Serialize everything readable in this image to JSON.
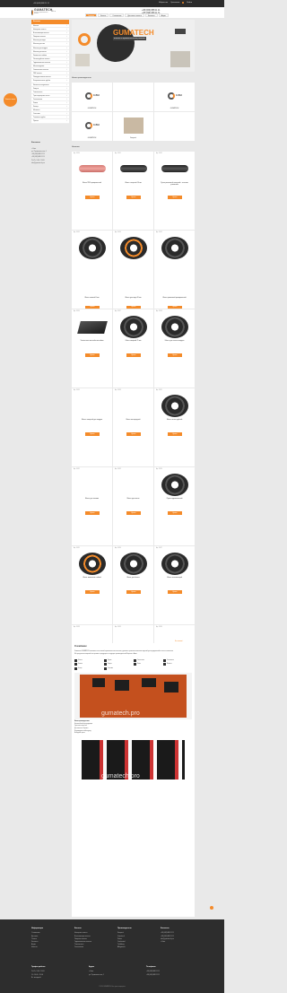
{
  "topbar": {
    "left_text": "+38 (063) 888 11 11",
    "right_items": [
      "Избранное",
      "Сравнение",
      "Войти"
    ]
  },
  "header": {
    "logo": "GUMATECH",
    "logo_tagline": "шланги и промышленные резинки",
    "language": "RU ▾",
    "phone1": "+38 (063) 888 11 11",
    "phone2": "+38 (096) 888 11 11",
    "nav": [
      "Главная",
      "Каталог",
      "О компании",
      "Доставка и оплата",
      "Контакты",
      "Акции"
    ]
  },
  "sidebar": {
    "title": "Каталог",
    "items": [
      "Шланги",
      "Напорные шланги",
      "Всасывающие шланги",
      "Пищевые шланги",
      "Шланги для воды",
      "Шланги для газа",
      "Шланги для воздуха",
      "Шланги для масла",
      "Химически стойкие",
      "Пескоструйные шланги",
      "Гидравлические шланги",
      "Металлорукава",
      "Силиконовые шланги",
      "ПВХ шланги",
      "Полиуретановые шланги",
      "Фторопластовые трубки",
      "Фитинги и соединения",
      "Хомуты",
      "Техпластины",
      "Транспортерные ленты",
      "Уплотнители",
      "Ремни",
      "Кольца",
      "Манжеты",
      "Сальники",
      "Тепловые трубки",
      "Прочее"
    ],
    "contacts_title": "Контакты",
    "contacts": [
      "г. Киев",
      "ул. Промышленная, 1",
      "+38 (063) 888 11 11",
      "+38 (096) 888 11 11",
      "Пн-Пт: 9:00 - 18:00",
      "info@gumatech.pro"
    ]
  },
  "hero": {
    "brand": "GUMATECH",
    "tagline": "шланги и промышленные резинки"
  },
  "brands": {
    "title": "Наши производители",
    "items": [
      {
        "label": "GUMATECH"
      },
      {
        "label": "GUMATECH"
      },
      {
        "label": "GUMATECH"
      },
      {
        "label": "GUMATECH"
      },
      {
        "label": "Semperit"
      }
    ]
  },
  "products_title": "Новинки",
  "products": [
    {
      "cat": "Арт. 10010",
      "name": "Шланг ПВХ армированный",
      "price": "",
      "btn": "Купить",
      "type": "tube pink"
    },
    {
      "cat": "Арт. 10011",
      "name": "Шланг напорный 16 мм",
      "price": "",
      "btn": "Купить",
      "type": "tube"
    },
    {
      "cat": "Арт. 10012",
      "name": "Рукав резиновый напорный с нитяным усилением",
      "price": "",
      "btn": "Купить",
      "type": "tube"
    },
    {
      "cat": "Арт. 10013",
      "name": "Шланг газовый 9 мм",
      "price": "",
      "btn": "Купить",
      "type": "hose"
    },
    {
      "cat": "Арт. 10014",
      "name": "Шланг для воды 20 мм",
      "price": "",
      "btn": "Купить",
      "type": "hose orange"
    },
    {
      "cat": "Арт. 10015",
      "name": "Шланг резиновый армированный",
      "price": "",
      "btn": "Купить",
      "type": "hose"
    },
    {
      "cat": "Арт. 10016",
      "name": "Техпластина маслобензостойкая",
      "price": "",
      "btn": "Купить",
      "type": "sheet"
    },
    {
      "cat": "Арт. 10017",
      "name": "Шланг пищевой 25 мм",
      "price": "",
      "btn": "Купить",
      "type": "hose"
    },
    {
      "cat": "Арт. 10018",
      "name": "Шланг для сжатого воздуха",
      "price": "",
      "btn": "Купить",
      "type": "hose"
    },
    {
      "cat": "Арт. 10019",
      "name": "Шланг напорный для воздуха",
      "price": "",
      "btn": "Купить",
      "type": ""
    },
    {
      "cat": "Арт. 10020",
      "name": "Шланг кислородный",
      "price": "",
      "btn": "Купить",
      "type": ""
    },
    {
      "cat": "Арт. 10021",
      "name": "Шланг пескоструйный",
      "price": "",
      "btn": "Купить",
      "type": "hose"
    },
    {
      "cat": "Арт. 10022",
      "name": "Шланг для топлива",
      "price": "",
      "btn": "Купить",
      "type": ""
    },
    {
      "cat": "Арт. 10023",
      "name": "Шланг для масла",
      "price": "",
      "btn": "Купить",
      "type": ""
    },
    {
      "cat": "Арт. 10024",
      "name": "Рукав гидравлический",
      "price": "",
      "btn": "Купить",
      "type": "hose"
    },
    {
      "cat": "Арт. 10025",
      "name": "Шланг химически стойкий",
      "price": "",
      "btn": "Купить",
      "type": "hose orange"
    },
    {
      "cat": "Арт. 10026",
      "name": "Шланг для бетона",
      "price": "",
      "btn": "Купить",
      "type": "hose"
    },
    {
      "cat": "Арт. 10027",
      "name": "Шланг всасывающий",
      "price": "",
      "btn": "Купить",
      "type": "hose"
    },
    {
      "cat": "Арт. 10028",
      "name": "Шланг паровой",
      "price": "",
      "btn": "Купить",
      "type": ""
    },
    {
      "cat": "Арт. 10029",
      "name": "Шланг пищевой",
      "price": "",
      "btn": "Купить",
      "type": ""
    },
    {
      "cat": "Арт. 10030",
      "name": "Шланг для кислот",
      "price": "",
      "btn": "Купить",
      "type": ""
    },
    {
      "cat": "Арт. 10031",
      "name": "Шланг силиконовый",
      "price": "",
      "btn": "Купить",
      "type": ""
    }
  ],
  "more_link": "Все новинки »",
  "about": {
    "title": "О компании",
    "p1": "Компания GUMATECH занимается поставкой промышленных шлангов, рукавов и резинотехнических изделий для предприятий и частных клиентов.",
    "p2": "Мы предлагаем широкий ассортимент продукции от ведущих производителей Европы и Азии.",
    "features": [
      "Шланги",
      "Рукава",
      "Техпластины",
      "Уплотнители",
      "Фитинги",
      "Хомуты",
      "Ремни",
      "Манжеты",
      "Кольца",
      "Сальники"
    ],
    "watermark": "gumatech.pro",
    "list_title": "Наши преимущества:",
    "list": [
      "Большой выбор продукции",
      "Гарантия качества",
      "Доставка по Украине",
      "Индивидуальный подход",
      "Выгодные цены"
    ]
  },
  "footer": {
    "cols": [
      {
        "title": "Информация",
        "items": [
          "О компании",
          "Доставка",
          "Оплата",
          "Контакты",
          "Акции",
          "Новости"
        ]
      },
      {
        "title": "Каталог",
        "items": [
          "Напорные шланги",
          "Всасывающие шланги",
          "Пищевые шланги",
          "Гидравлические шланги",
          "Техпластины",
          "Уплотнители"
        ]
      },
      {
        "title": "Производители",
        "items": [
          "Semperit",
          "Gumatech",
          "Parker",
          "Continental",
          "Trelleborg",
          "Alfagomma"
        ]
      },
      {
        "title": "Контакты",
        "items": [
          "+38 (063) 888 11 11",
          "+38 (096) 888 11 11",
          "info@gumatech.pro",
          "г. Киев"
        ]
      }
    ],
    "bottom": [
      {
        "title": "График работы",
        "items": [
          "Пн-Пт: 9:00 - 18:00",
          "Сб: 10:00 - 15:00",
          "Вс: выходной"
        ]
      },
      {
        "title": "Адрес",
        "items": [
          "г. Киев",
          "ул. Промышленная, 1"
        ]
      },
      {
        "title": "Телефоны",
        "items": [
          "+38 (063) 888 11 11",
          "+38 (096) 888 11 11"
        ]
      }
    ],
    "copyright": "© 2024 GUMATECH. Все права защищены."
  },
  "callback": "Заказать звонок"
}
